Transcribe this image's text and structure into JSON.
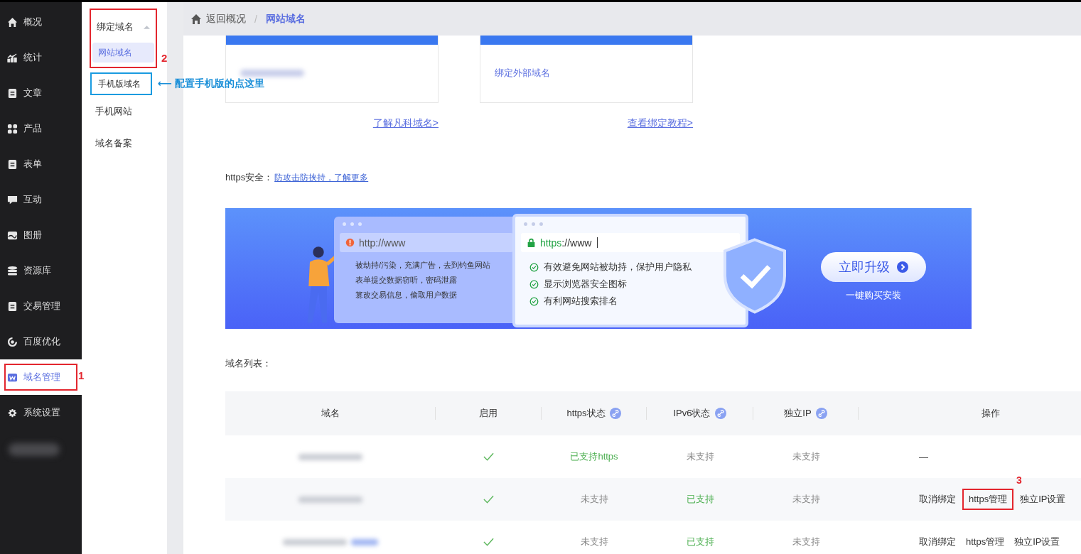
{
  "sidebar": {
    "items": [
      {
        "label": "概况",
        "selected": false
      },
      {
        "label": "统计",
        "selected": false
      },
      {
        "label": "文章",
        "selected": false
      },
      {
        "label": "产品",
        "selected": false
      },
      {
        "label": "表单",
        "selected": false
      },
      {
        "label": "互动",
        "selected": false
      },
      {
        "label": "图册",
        "selected": false
      },
      {
        "label": "资源库",
        "selected": false
      },
      {
        "label": "交易管理",
        "selected": false
      },
      {
        "label": "百度优化",
        "selected": false
      },
      {
        "label": "域名管理",
        "selected": true
      },
      {
        "label": "系统设置",
        "selected": false
      }
    ],
    "marker": "1"
  },
  "subnav": {
    "group": {
      "label": "绑定域名",
      "expanded": true,
      "children": [
        {
          "label": "网站域名",
          "selected": true
        }
      ]
    },
    "marker": "2",
    "items": [
      {
        "label": "手机版域名",
        "highlighted": true
      },
      {
        "label": "手机网站",
        "highlighted": false
      },
      {
        "label": "域名备案",
        "highlighted": false
      }
    ],
    "note": "⟵ 配置手机版的点这里"
  },
  "breadcrumb": {
    "back": "返回概况",
    "separator": "/",
    "current": "网站域名"
  },
  "cards": [
    {
      "link": "了解凡科域名>"
    },
    {
      "text": "绑定外部域名",
      "link": "查看绑定教程>"
    }
  ],
  "https_security": {
    "label": "https安全：",
    "link": "防攻击防挟持，了解更多"
  },
  "banner": {
    "old_url": "http://www",
    "risks": [
      "被劫持/污染，充满广告，去到钓鱼网站",
      "表单提交数据窃听，密码泄露",
      "篡改交易信息，偷取用户数据"
    ],
    "new_scheme": "https",
    "new_rest": "://www",
    "benefits": [
      "有效避免网站被劫持，保护用户隐私",
      "显示浏览器安全图标",
      "有利网站搜索排名"
    ],
    "button": "立即升级",
    "subtitle": "一键购买安装"
  },
  "table": {
    "title": "域名列表：",
    "marker": "3",
    "columns": [
      {
        "label": "域名",
        "kind": "plain"
      },
      {
        "label": "启用",
        "kind": "plain"
      },
      {
        "label": "https状态",
        "kind": "linked"
      },
      {
        "label": "IPv6状态",
        "kind": "linked"
      },
      {
        "label": "独立IP",
        "kind": "linked"
      },
      {
        "label": "操作",
        "kind": "plain"
      }
    ],
    "rows": [
      {
        "kind": "plain",
        "enabled": true,
        "https": {
          "text": "已支持https",
          "supported": true
        },
        "ipv6": {
          "text": "未支持",
          "supported": false
        },
        "ip": "未支持",
        "actions": [
          {
            "label": "—",
            "boxed": false
          }
        ]
      },
      {
        "kind": "plain",
        "enabled": true,
        "https": {
          "text": "未支持",
          "supported": false
        },
        "ipv6": {
          "text": "已支持",
          "supported": true
        },
        "ip": "未支持",
        "actions": [
          {
            "label": "取消绑定",
            "boxed": false
          },
          {
            "label": "https管理",
            "boxed": true
          },
          {
            "label": "独立IP设置",
            "boxed": false
          }
        ]
      },
      {
        "kind": "tagged",
        "enabled": true,
        "https": {
          "text": "未支持",
          "supported": false
        },
        "ipv6": {
          "text": "已支持",
          "supported": true
        },
        "ip": "未支持",
        "actions": [
          {
            "label": "取消绑定",
            "boxed": false
          },
          {
            "label": "https管理",
            "boxed": false
          },
          {
            "label": "独立IP设置",
            "boxed": false
          }
        ]
      }
    ]
  }
}
